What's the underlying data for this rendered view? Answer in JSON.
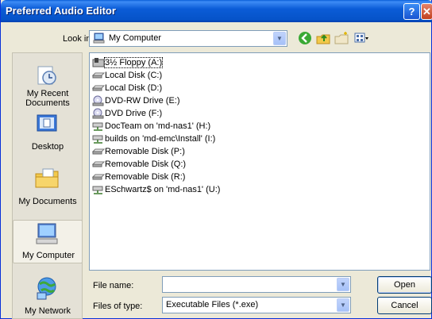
{
  "window": {
    "title": "Preferred Audio Editor",
    "help_glyph": "?",
    "close_glyph": "✕"
  },
  "lookin": {
    "label": "Look in:",
    "value": "My Computer"
  },
  "places": [
    {
      "id": "recent",
      "label": "My Recent Documents"
    },
    {
      "id": "desktop",
      "label": "Desktop"
    },
    {
      "id": "documents",
      "label": "My Documents"
    },
    {
      "id": "computer",
      "label": "My Computer"
    },
    {
      "id": "network",
      "label": "My Network"
    }
  ],
  "files": [
    {
      "name": "3½ Floppy (A:)",
      "icon": "floppy-drive-icon"
    },
    {
      "name": "Local Disk (C:)",
      "icon": "hard-disk-icon"
    },
    {
      "name": "Local Disk (D:)",
      "icon": "hard-disk-icon"
    },
    {
      "name": "DVD-RW Drive (E:)",
      "icon": "optical-drive-icon"
    },
    {
      "name": "DVD Drive (F:)",
      "icon": "optical-drive-icon"
    },
    {
      "name": "DocTeam on 'md-nas1' (H:)",
      "icon": "network-drive-icon"
    },
    {
      "name": "builds on 'md-emc\\Install' (I:)",
      "icon": "network-drive-icon"
    },
    {
      "name": "Removable Disk (P:)",
      "icon": "hard-disk-icon"
    },
    {
      "name": "Removable Disk (Q:)",
      "icon": "hard-disk-icon"
    },
    {
      "name": "Removable Disk (R:)",
      "icon": "hard-disk-icon"
    },
    {
      "name": "ESchwartz$ on 'md-nas1' (U:)",
      "icon": "network-drive-icon"
    }
  ],
  "form": {
    "filename_label": "File name:",
    "filename_value": "",
    "filetype_label": "Files of type:",
    "filetype_value": "Executable Files (*.exe)"
  },
  "buttons": {
    "open": "Open",
    "cancel": "Cancel"
  },
  "colors": {
    "title_bar": "#0a5fd8",
    "dialog_bg": "#ece9d8",
    "field_border": "#7f9db9"
  }
}
